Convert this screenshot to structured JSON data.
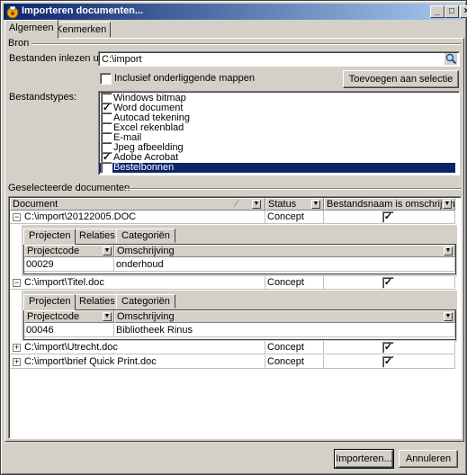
{
  "window": {
    "title": "Importeren documenten...",
    "controls": {
      "minimize": "_",
      "maximize": "□",
      "close": "×"
    }
  },
  "tabs": [
    {
      "label": "Algemeen",
      "active": true
    },
    {
      "label": "Kenmerken",
      "active": false
    }
  ],
  "bron": {
    "group_label": "Bron",
    "path_label": "Bestanden inlezen uit:",
    "path_value": "C:\\import",
    "include_sub_label": "Inclusief onderliggende mappen",
    "include_sub_checked": false,
    "add_selection_label": "Toevoegen aan selectie",
    "types_label": "Bestandstypes:",
    "types": [
      {
        "label": "Windows bitmap",
        "checked": false,
        "selected": false
      },
      {
        "label": "Word document",
        "checked": true,
        "selected": false
      },
      {
        "label": "Autocad tekening",
        "checked": false,
        "selected": false
      },
      {
        "label": "Excel rekenblad",
        "checked": false,
        "selected": false
      },
      {
        "label": "E-mail",
        "checked": false,
        "selected": false
      },
      {
        "label": "Jpeg afbeelding",
        "checked": false,
        "selected": false
      },
      {
        "label": "Adobe Acrobat",
        "checked": true,
        "selected": false
      },
      {
        "label": "Bestelbonnen",
        "checked": true,
        "selected": true
      }
    ]
  },
  "selected_docs": {
    "group_label": "Geselecteerde documenten",
    "columns": {
      "document": "Document",
      "status": "Status",
      "filename_desc": "Bestandsnaam is omschrijving"
    },
    "sub_tabs": [
      "Projecten",
      "Relaties",
      "Categoriën"
    ],
    "sub_columns": {
      "projectcode": "Projectcode",
      "omschrijving": "Omschrijving"
    },
    "rows": [
      {
        "document": "C:\\import\\20122005.DOC",
        "status": "Concept",
        "checked": true,
        "expanded": true,
        "expander": "−",
        "project": {
          "code": "00029",
          "omschrijving": "onderhoud"
        }
      },
      {
        "document": "C:\\import\\Titel.doc",
        "status": "Concept",
        "checked": true,
        "expanded": true,
        "expander": "−",
        "project": {
          "code": "00046",
          "omschrijving": "Bibliotheek Rinus"
        }
      },
      {
        "document": "C:\\import\\Utrecht.doc",
        "status": "Concept",
        "checked": true,
        "expanded": false,
        "expander": "+"
      },
      {
        "document": "C:\\import\\brief Quick Print.doc",
        "status": "Concept",
        "checked": true,
        "expanded": false,
        "expander": "+"
      }
    ]
  },
  "footer": {
    "import_label": "Importeren...",
    "cancel_label": "Annuleren"
  }
}
